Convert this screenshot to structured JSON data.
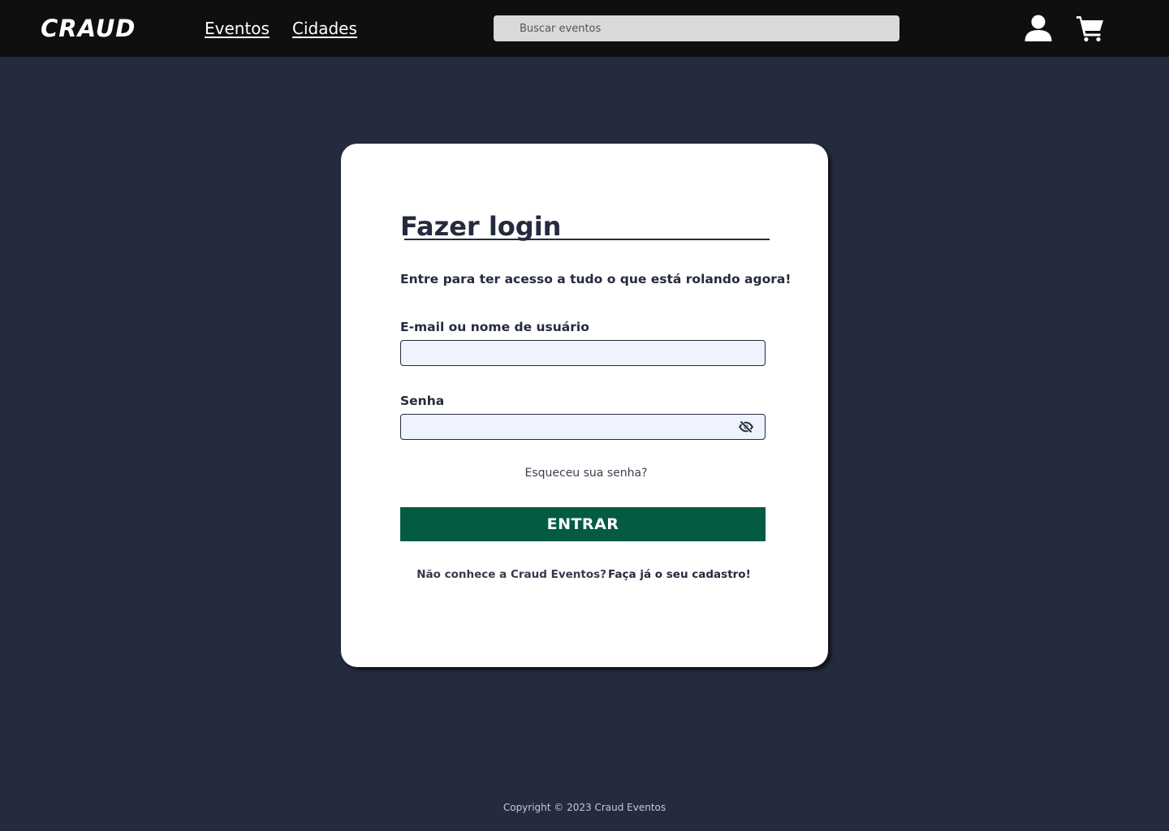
{
  "header": {
    "logo": "CRAUD",
    "nav": [
      {
        "label": "Eventos"
      },
      {
        "label": "Cidades"
      }
    ],
    "search": {
      "placeholder": "Buscar eventos",
      "value": ""
    },
    "icons": {
      "account": "user-icon",
      "cart": "cart-icon"
    }
  },
  "login": {
    "title": "Fazer login",
    "subtitle": "Entre para ter acesso a tudo o que está rolando agora!",
    "email_label": "E-mail ou nome de usuário",
    "email_value": "",
    "password_label": "Senha",
    "password_value": "",
    "password_toggle_icon": "eye-slash-icon",
    "forgot": "Esqueceu sua senha?",
    "submit": "ENTRAR",
    "signup_question": "Não conhece a Craud Eventos?",
    "signup_link": "Faça já o seu cadastro!"
  },
  "footer": {
    "copyright": "Copyright © 2023 Craud Eventos"
  },
  "colors": {
    "background": "#242b3e",
    "header": "#0f0f0f",
    "card": "#ffffff",
    "accent": "#045b43",
    "input_fill": "#eef3fe",
    "search_fill": "#d9d9d9"
  }
}
